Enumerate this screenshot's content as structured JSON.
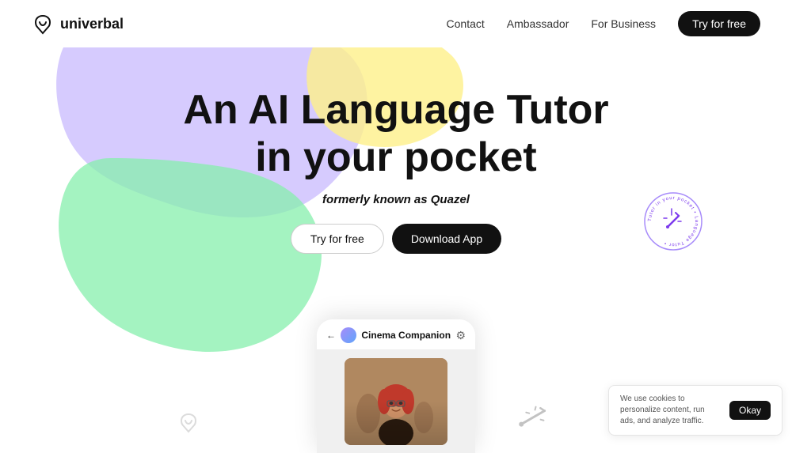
{
  "navbar": {
    "logo_text": "univerbal",
    "nav_links": [
      {
        "label": "Contact",
        "id": "contact"
      },
      {
        "label": "Ambassador",
        "id": "ambassador"
      },
      {
        "label": "For Business",
        "id": "for-business"
      }
    ],
    "cta_label": "Try for free"
  },
  "hero": {
    "title_line1": "An AI Language Tutor",
    "title_line2": "in your pocket",
    "subtitle_prefix": "formerly known as ",
    "subtitle_brand": "Quazel",
    "btn_try": "Try for free",
    "btn_download": "Download App"
  },
  "phone": {
    "back_label": "←",
    "chat_title": "Cinema Companion",
    "settings_icon": "⚙"
  },
  "cookie": {
    "text": "We use cookies to personalize content, run ads, and analyze traffic.",
    "ok_label": "Okay"
  },
  "badge": {
    "text": "Tutor in your pocket • Language Tutor in your pocket • Language"
  },
  "blobs": {
    "purple": "#d8b4fe",
    "yellow": "#fef08a",
    "green": "#86efac"
  }
}
